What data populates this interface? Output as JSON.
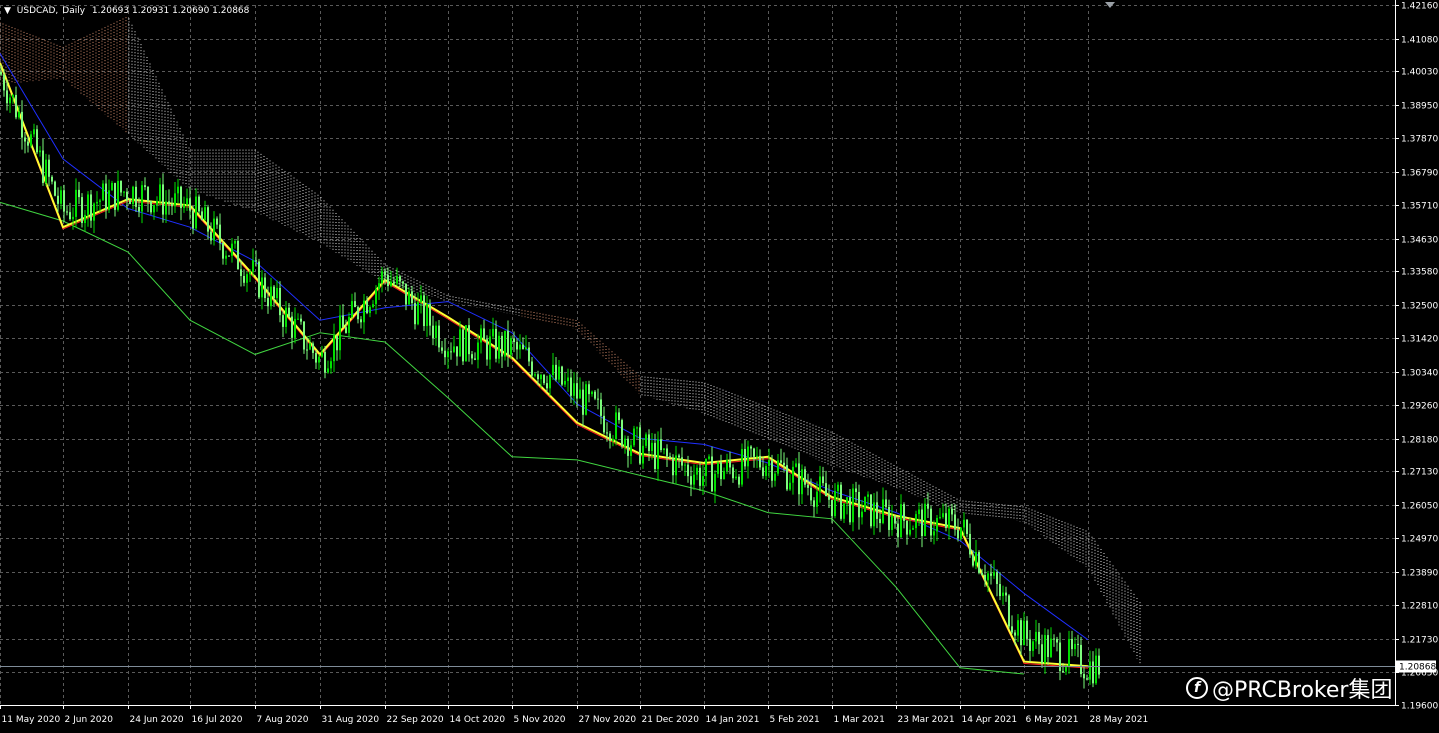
{
  "header": {
    "arrow": "▼",
    "symbol": "USDCAD,",
    "timeframe": "Daily",
    "ohlc": "1.20693 1.20931 1.20690 1.20868"
  },
  "watermark": {
    "text": "@PRCBroker集团",
    "icon": "prc-logo-icon"
  },
  "colors": {
    "background": "#000000",
    "grid": "#5a5a5a",
    "bull_candle": "#00e000",
    "bear_candle": "#7cfc7c",
    "price_line": "#7f8c99",
    "kijun": "#1f2fff",
    "tenkan": "#ff2020",
    "ma": "#ffff33",
    "chikou": "#41d641",
    "cloud_bull": "#ffffff",
    "cloud_bear": "#f2a07c"
  },
  "chart_data": {
    "type": "candlestick",
    "symbol": "USDCAD",
    "timeframe": "Daily",
    "current_price": 1.20868,
    "current_price_label": "1.20868",
    "y_ticks": [
      "1.42160",
      "1.41080",
      "1.40030",
      "1.38950",
      "1.37870",
      "1.36790",
      "1.35710",
      "1.34630",
      "1.33580",
      "1.32500",
      "1.31420",
      "1.30340",
      "1.29260",
      "1.28180",
      "1.27130",
      "1.26050",
      "1.24970",
      "1.23890",
      "1.22810",
      "1.21730",
      "1.20650",
      "1.19600"
    ],
    "x_ticks": [
      "11 May 2020",
      "2 Jun 2020",
      "24 Jun 2020",
      "16 Jul 2020",
      "7 Aug 2020",
      "31 Aug 2020",
      "22 Sep 2020",
      "14 Oct 2020",
      "5 Nov 2020",
      "27 Nov 2020",
      "21 Dec 2020",
      "14 Jan 2021",
      "5 Feb 2021",
      "1 Mar 2021",
      "23 Mar 2021",
      "14 Apr 2021",
      "6 May 2021",
      "28 May 2021"
    ],
    "ylim": [
      1.196,
      1.4216
    ],
    "close_path": [
      [
        "11 May 2020",
        1.4
      ],
      [
        "2 Jun 2020",
        1.355
      ],
      [
        "24 Jun 2020",
        1.362
      ],
      [
        "16 Jul 2020",
        1.356
      ],
      [
        "7 Aug 2020",
        1.334
      ],
      [
        "31 Aug 2020",
        1.307
      ],
      [
        "22 Sep 2020",
        1.335
      ],
      [
        "14 Oct 2020",
        1.313
      ],
      [
        "5 Nov 2020",
        1.311
      ],
      [
        "27 Nov 2020",
        1.296
      ],
      [
        "21 Dec 2020",
        1.279
      ],
      [
        "14 Jan 2021",
        1.27
      ],
      [
        "5 Feb 2021",
        1.275
      ],
      [
        "1 Mar 2021",
        1.262
      ],
      [
        "23 Mar 2021",
        1.256
      ],
      [
        "14 Apr 2021",
        1.254
      ],
      [
        "6 May 2021",
        1.218
      ],
      [
        "28 May 2021",
        1.2087
      ]
    ],
    "ma_path": [
      [
        "11 May 2020",
        1.403
      ],
      [
        "2 Jun 2020",
        1.35
      ],
      [
        "24 Jun 2020",
        1.359
      ],
      [
        "16 Jul 2020",
        1.357
      ],
      [
        "7 Aug 2020",
        1.334
      ],
      [
        "31 Aug 2020",
        1.309
      ],
      [
        "22 Sep 2020",
        1.333
      ],
      [
        "14 Oct 2020",
        1.321
      ],
      [
        "5 Nov 2020",
        1.308
      ],
      [
        "27 Nov 2020",
        1.287
      ],
      [
        "21 Dec 2020",
        1.277
      ],
      [
        "14 Jan 2021",
        1.274
      ],
      [
        "5 Feb 2021",
        1.276
      ],
      [
        "1 Mar 2021",
        1.263
      ],
      [
        "23 Mar 2021",
        1.257
      ],
      [
        "14 Apr 2021",
        1.253
      ],
      [
        "6 May 2021",
        1.21
      ],
      [
        "28 May 2021",
        1.2085
      ]
    ],
    "kijun_path": [
      [
        "11 May 2020",
        1.406
      ],
      [
        "2 Jun 2020",
        1.372
      ],
      [
        "24 Jun 2020",
        1.356
      ],
      [
        "16 Jul 2020",
        1.35
      ],
      [
        "7 Aug 2020",
        1.339
      ],
      [
        "31 Aug 2020",
        1.32
      ],
      [
        "22 Sep 2020",
        1.324
      ],
      [
        "14 Oct 2020",
        1.326
      ],
      [
        "5 Nov 2020",
        1.316
      ],
      [
        "27 Nov 2020",
        1.293
      ],
      [
        "21 Dec 2020",
        1.282
      ],
      [
        "14 Jan 2021",
        1.28
      ],
      [
        "5 Feb 2021",
        1.274
      ],
      [
        "1 Mar 2021",
        1.265
      ],
      [
        "23 Mar 2021",
        1.258
      ],
      [
        "14 Apr 2021",
        1.249
      ],
      [
        "6 May 2021",
        1.232
      ],
      [
        "28 May 2021",
        1.217
      ]
    ],
    "chikou_path": [
      [
        "11 May 2020",
        1.358
      ],
      [
        "2 Jun 2020",
        1.352
      ],
      [
        "24 Jun 2020",
        1.342
      ],
      [
        "16 Jul 2020",
        1.32
      ],
      [
        "7 Aug 2020",
        1.309
      ],
      [
        "31 Aug 2020",
        1.316
      ],
      [
        "22 Sep 2020",
        1.313
      ],
      [
        "14 Oct 2020",
        1.295
      ],
      [
        "5 Nov 2020",
        1.276
      ],
      [
        "27 Nov 2020",
        1.275
      ],
      [
        "21 Dec 2020",
        1.27
      ],
      [
        "14 Jan 2021",
        1.265
      ],
      [
        "5 Feb 2021",
        1.258
      ],
      [
        "1 Mar 2021",
        1.256
      ],
      [
        "23 Mar 2021",
        1.234
      ],
      [
        "14 Apr 2021",
        1.208
      ],
      [
        "6 May 2021",
        1.206
      ]
    ],
    "cloud_top": [
      [
        "11 May 2020",
        1.416
      ],
      [
        "2 Jun 2020",
        1.408
      ],
      [
        "24 Jun 2020",
        1.418
      ],
      [
        "16 Jul 2020",
        1.375
      ],
      [
        "7 Aug 2020",
        1.375
      ],
      [
        "31 Aug 2020",
        1.36
      ],
      [
        "22 Sep 2020",
        1.338
      ],
      [
        "14 Oct 2020",
        1.328
      ],
      [
        "5 Nov 2020",
        1.324
      ],
      [
        "27 Nov 2020",
        1.32
      ],
      [
        "21 Dec 2020",
        1.302
      ],
      [
        "14 Jan 2021",
        1.3
      ],
      [
        "5 Feb 2021",
        1.292
      ],
      [
        "1 Mar 2021",
        1.284
      ],
      [
        "23 Mar 2021",
        1.273
      ],
      [
        "14 Apr 2021",
        1.262
      ],
      [
        "6 May 2021",
        1.26
      ],
      [
        "28 May 2021",
        1.252
      ],
      [
        "15 Jun 2021",
        1.229
      ]
    ],
    "cloud_bottom": [
      [
        "11 May 2020",
        1.396
      ],
      [
        "2 Jun 2020",
        1.398
      ],
      [
        "24 Jun 2020",
        1.38
      ],
      [
        "16 Jul 2020",
        1.362
      ],
      [
        "7 Aug 2020",
        1.355
      ],
      [
        "31 Aug 2020",
        1.345
      ],
      [
        "22 Sep 2020",
        1.332
      ],
      [
        "14 Oct 2020",
        1.326
      ],
      [
        "5 Nov 2020",
        1.322
      ],
      [
        "27 Nov 2020",
        1.317
      ],
      [
        "21 Dec 2020",
        1.296
      ],
      [
        "14 Jan 2021",
        1.29
      ],
      [
        "5 Feb 2021",
        1.282
      ],
      [
        "1 Mar 2021",
        1.273
      ],
      [
        "23 Mar 2021",
        1.266
      ],
      [
        "14 Apr 2021",
        1.258
      ],
      [
        "6 May 2021",
        1.255
      ],
      [
        "28 May 2021",
        1.24
      ],
      [
        "15 Jun 2021",
        1.209
      ]
    ]
  }
}
